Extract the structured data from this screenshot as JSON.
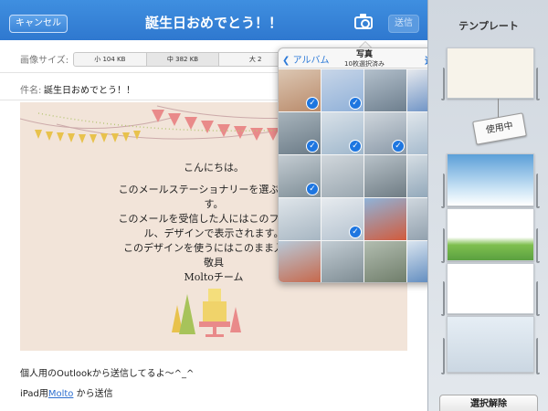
{
  "header": {
    "cancel_label": "キャンセル",
    "title": "誕生日おめでとう！！",
    "camera_icon": "camera-icon",
    "send_label": "送信"
  },
  "compose": {
    "image_size_label": "画像サイズ:",
    "size_options": [
      "小 104 KB",
      "中 382 KB",
      "大 2"
    ],
    "selected_size": "中 382 KB",
    "subject_label": "件名:",
    "subject_value": "誕生日おめでとう！！",
    "stationery": {
      "greeting": "こんにちは。",
      "line1": "このメールステーショナリーを選ぶとこん",
      "line2": "す。",
      "line3": "このメールを受信した人にはこのフォント",
      "line4": "ル、デザインで表示されます。",
      "line5": "このデザインを使うにはこのまま入力し",
      "closing": "敬具",
      "signature": "Moltoチーム"
    },
    "footer_line1": "個人用のOutlookから送信してるよ〜^_^",
    "footer_prefix": "iPad用",
    "footer_link": "Molto",
    "footer_suffix": " から送信"
  },
  "photo_picker": {
    "back_label": "アルバム",
    "title": "写真",
    "subtitle": "10枚選択済み",
    "add_label": "追加",
    "check_glyph": "✓",
    "photos": [
      {
        "colors": [
          "#b98a6a",
          "#dcc7b3"
        ],
        "selected": true
      },
      {
        "colors": [
          "#8fb0d8",
          "#c8d6e8"
        ],
        "selected": true
      },
      {
        "colors": [
          "#6e7f8e",
          "#b3c0cc"
        ],
        "selected": false
      },
      {
        "colors": [
          "#5f88c0",
          "#e6e9ee"
        ],
        "selected": true
      },
      {
        "colors": [
          "#6a7a86",
          "#a8b4bc"
        ],
        "selected": true
      },
      {
        "colors": [
          "#9fb7cc",
          "#d9e1e8"
        ],
        "selected": true
      },
      {
        "colors": [
          "#8a99a8",
          "#cfd6dc"
        ],
        "selected": true
      },
      {
        "colors": [
          "#9db4c9",
          "#e0e6eb"
        ],
        "selected": true
      },
      {
        "colors": [
          "#7d8d96",
          "#c4ccd2"
        ],
        "selected": true
      },
      {
        "colors": [
          "#9aa7b0",
          "#d1d7dc"
        ],
        "selected": false
      },
      {
        "colors": [
          "#6f7c84",
          "#b8c2c9"
        ],
        "selected": false
      },
      {
        "colors": [
          "#88a0b4",
          "#d5dde3"
        ],
        "selected": false
      },
      {
        "colors": [
          "#a7b6c2",
          "#dfe5ea"
        ],
        "selected": false
      },
      {
        "colors": [
          "#b4c2cf",
          "#e7ebef"
        ],
        "selected": true
      },
      {
        "colors": [
          "#d25b3c",
          "#8fb3d9"
        ],
        "selected": false
      },
      {
        "colors": [
          "#8898a6",
          "#cfd7de"
        ],
        "selected": true
      },
      {
        "colors": [
          "#c7674a",
          "#b8c9d8"
        ],
        "selected": false
      },
      {
        "colors": [
          "#7e8c93",
          "#c2ccd3"
        ],
        "selected": false
      },
      {
        "colors": [
          "#6f7d6a",
          "#b2bdb0"
        ],
        "selected": false
      },
      {
        "colors": [
          "#4f7fb8",
          "#d9e4ef"
        ],
        "selected": false
      }
    ]
  },
  "template_panel": {
    "title": "テンプレート",
    "in_use_label": "使用中",
    "deselect_label": "選択解除"
  },
  "colors": {
    "header_blue": "#2f78cf",
    "accent_blue": "#1e76e0",
    "link_blue": "#2d6fd0"
  }
}
